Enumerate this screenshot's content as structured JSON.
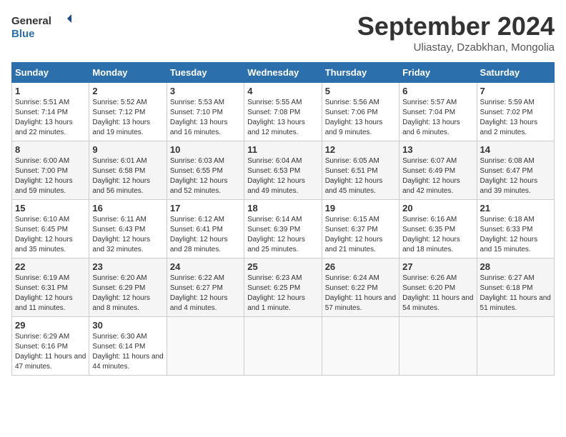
{
  "header": {
    "logo_line1": "General",
    "logo_line2": "Blue",
    "month_title": "September 2024",
    "subtitle": "Uliastay, Dzabkhan, Mongolia"
  },
  "days_of_week": [
    "Sunday",
    "Monday",
    "Tuesday",
    "Wednesday",
    "Thursday",
    "Friday",
    "Saturday"
  ],
  "weeks": [
    [
      {
        "day": 1,
        "sunrise": "Sunrise: 5:51 AM",
        "sunset": "Sunset: 7:14 PM",
        "daylight": "Daylight: 13 hours and 22 minutes."
      },
      {
        "day": 2,
        "sunrise": "Sunrise: 5:52 AM",
        "sunset": "Sunset: 7:12 PM",
        "daylight": "Daylight: 13 hours and 19 minutes."
      },
      {
        "day": 3,
        "sunrise": "Sunrise: 5:53 AM",
        "sunset": "Sunset: 7:10 PM",
        "daylight": "Daylight: 13 hours and 16 minutes."
      },
      {
        "day": 4,
        "sunrise": "Sunrise: 5:55 AM",
        "sunset": "Sunset: 7:08 PM",
        "daylight": "Daylight: 13 hours and 12 minutes."
      },
      {
        "day": 5,
        "sunrise": "Sunrise: 5:56 AM",
        "sunset": "Sunset: 7:06 PM",
        "daylight": "Daylight: 13 hours and 9 minutes."
      },
      {
        "day": 6,
        "sunrise": "Sunrise: 5:57 AM",
        "sunset": "Sunset: 7:04 PM",
        "daylight": "Daylight: 13 hours and 6 minutes."
      },
      {
        "day": 7,
        "sunrise": "Sunrise: 5:59 AM",
        "sunset": "Sunset: 7:02 PM",
        "daylight": "Daylight: 13 hours and 2 minutes."
      }
    ],
    [
      {
        "day": 8,
        "sunrise": "Sunrise: 6:00 AM",
        "sunset": "Sunset: 7:00 PM",
        "daylight": "Daylight: 12 hours and 59 minutes."
      },
      {
        "day": 9,
        "sunrise": "Sunrise: 6:01 AM",
        "sunset": "Sunset: 6:58 PM",
        "daylight": "Daylight: 12 hours and 56 minutes."
      },
      {
        "day": 10,
        "sunrise": "Sunrise: 6:03 AM",
        "sunset": "Sunset: 6:55 PM",
        "daylight": "Daylight: 12 hours and 52 minutes."
      },
      {
        "day": 11,
        "sunrise": "Sunrise: 6:04 AM",
        "sunset": "Sunset: 6:53 PM",
        "daylight": "Daylight: 12 hours and 49 minutes."
      },
      {
        "day": 12,
        "sunrise": "Sunrise: 6:05 AM",
        "sunset": "Sunset: 6:51 PM",
        "daylight": "Daylight: 12 hours and 45 minutes."
      },
      {
        "day": 13,
        "sunrise": "Sunrise: 6:07 AM",
        "sunset": "Sunset: 6:49 PM",
        "daylight": "Daylight: 12 hours and 42 minutes."
      },
      {
        "day": 14,
        "sunrise": "Sunrise: 6:08 AM",
        "sunset": "Sunset: 6:47 PM",
        "daylight": "Daylight: 12 hours and 39 minutes."
      }
    ],
    [
      {
        "day": 15,
        "sunrise": "Sunrise: 6:10 AM",
        "sunset": "Sunset: 6:45 PM",
        "daylight": "Daylight: 12 hours and 35 minutes."
      },
      {
        "day": 16,
        "sunrise": "Sunrise: 6:11 AM",
        "sunset": "Sunset: 6:43 PM",
        "daylight": "Daylight: 12 hours and 32 minutes."
      },
      {
        "day": 17,
        "sunrise": "Sunrise: 6:12 AM",
        "sunset": "Sunset: 6:41 PM",
        "daylight": "Daylight: 12 hours and 28 minutes."
      },
      {
        "day": 18,
        "sunrise": "Sunrise: 6:14 AM",
        "sunset": "Sunset: 6:39 PM",
        "daylight": "Daylight: 12 hours and 25 minutes."
      },
      {
        "day": 19,
        "sunrise": "Sunrise: 6:15 AM",
        "sunset": "Sunset: 6:37 PM",
        "daylight": "Daylight: 12 hours and 21 minutes."
      },
      {
        "day": 20,
        "sunrise": "Sunrise: 6:16 AM",
        "sunset": "Sunset: 6:35 PM",
        "daylight": "Daylight: 12 hours and 18 minutes."
      },
      {
        "day": 21,
        "sunrise": "Sunrise: 6:18 AM",
        "sunset": "Sunset: 6:33 PM",
        "daylight": "Daylight: 12 hours and 15 minutes."
      }
    ],
    [
      {
        "day": 22,
        "sunrise": "Sunrise: 6:19 AM",
        "sunset": "Sunset: 6:31 PM",
        "daylight": "Daylight: 12 hours and 11 minutes."
      },
      {
        "day": 23,
        "sunrise": "Sunrise: 6:20 AM",
        "sunset": "Sunset: 6:29 PM",
        "daylight": "Daylight: 12 hours and 8 minutes."
      },
      {
        "day": 24,
        "sunrise": "Sunrise: 6:22 AM",
        "sunset": "Sunset: 6:27 PM",
        "daylight": "Daylight: 12 hours and 4 minutes."
      },
      {
        "day": 25,
        "sunrise": "Sunrise: 6:23 AM",
        "sunset": "Sunset: 6:25 PM",
        "daylight": "Daylight: 12 hours and 1 minute."
      },
      {
        "day": 26,
        "sunrise": "Sunrise: 6:24 AM",
        "sunset": "Sunset: 6:22 PM",
        "daylight": "Daylight: 11 hours and 57 minutes."
      },
      {
        "day": 27,
        "sunrise": "Sunrise: 6:26 AM",
        "sunset": "Sunset: 6:20 PM",
        "daylight": "Daylight: 11 hours and 54 minutes."
      },
      {
        "day": 28,
        "sunrise": "Sunrise: 6:27 AM",
        "sunset": "Sunset: 6:18 PM",
        "daylight": "Daylight: 11 hours and 51 minutes."
      }
    ],
    [
      {
        "day": 29,
        "sunrise": "Sunrise: 6:29 AM",
        "sunset": "Sunset: 6:16 PM",
        "daylight": "Daylight: 11 hours and 47 minutes."
      },
      {
        "day": 30,
        "sunrise": "Sunrise: 6:30 AM",
        "sunset": "Sunset: 6:14 PM",
        "daylight": "Daylight: 11 hours and 44 minutes."
      },
      null,
      null,
      null,
      null,
      null
    ]
  ]
}
